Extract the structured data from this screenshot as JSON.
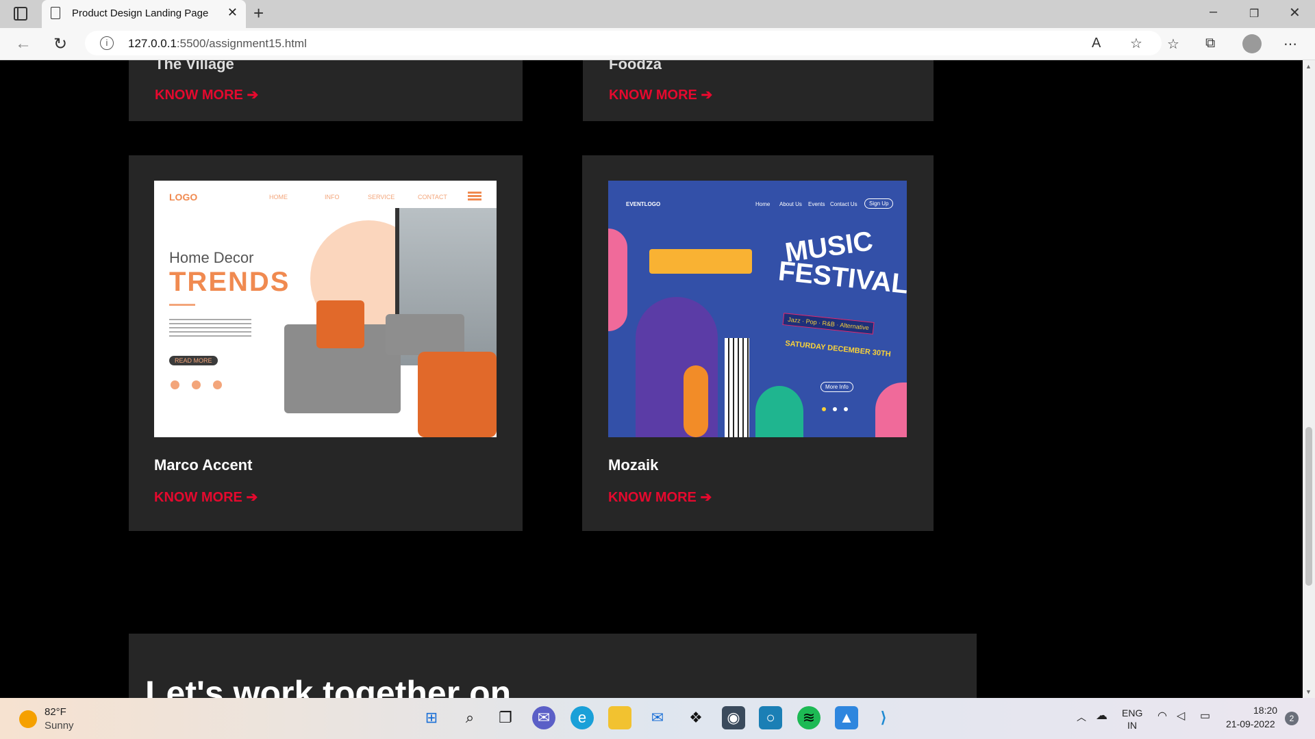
{
  "browser": {
    "tab_title": "Product Design Landing Page",
    "url_host": "127.0.0.1",
    "url_rest": ":5500/assignment15.html"
  },
  "cards_top": [
    {
      "title_partial": "The Village",
      "link": "KNOW MORE"
    },
    {
      "title_partial": "Foodza",
      "link": "KNOW MORE"
    }
  ],
  "cards": [
    {
      "title": "Marco Accent",
      "link": "KNOW MORE",
      "mock": {
        "logo": "LOGO",
        "nav": [
          "HOME",
          "INFO",
          "SERVICE",
          "CONTACT"
        ],
        "heading1": "Home Decor",
        "heading2": "TRENDS",
        "button": "READ MORE"
      }
    },
    {
      "title": "Mozaik",
      "link": "KNOW MORE",
      "mock": {
        "logo": "EVENTLOGO",
        "nav": [
          "Home",
          "About Us",
          "Events",
          "Contact Us"
        ],
        "signup": "Sign Up",
        "heading1": "MUSIC",
        "heading2": "FESTIVAL",
        "genres": "Jazz · Pop · R&B · Alternative",
        "date": "SATURDAY DECEMBER 30TH",
        "button": "More Info"
      }
    }
  ],
  "cta": {
    "text": "Let's work together on"
  },
  "taskbar": {
    "weather_temp": "82°F",
    "weather_desc": "Sunny",
    "lang1": "ENG",
    "lang2": "IN",
    "time": "18:20",
    "date": "21-09-2022",
    "notif": "2"
  },
  "colors": {
    "accent": "#e5092e",
    "card_bg": "#262626",
    "page_bg": "#000000"
  }
}
